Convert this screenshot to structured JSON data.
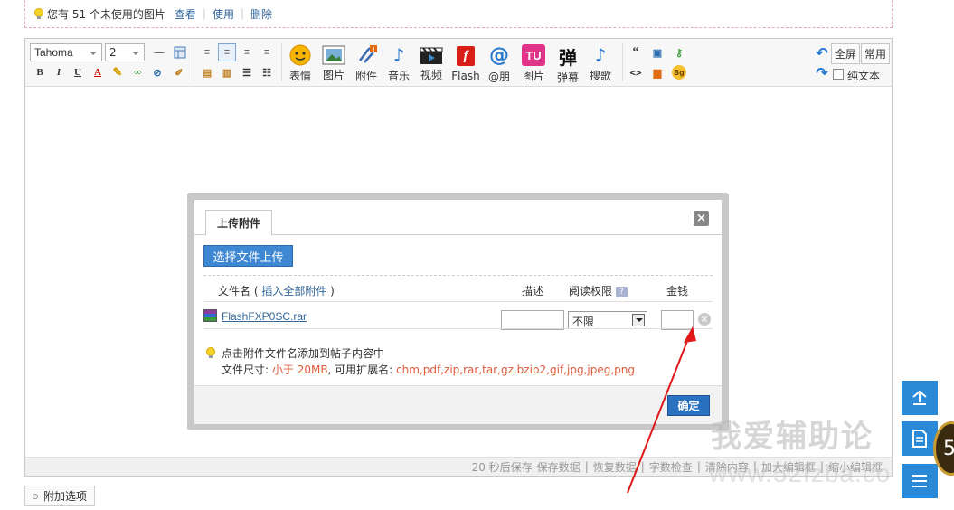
{
  "notice": {
    "text": "您有 51 个未使用的图片",
    "view": "查看",
    "use": "使用",
    "delete": "删除"
  },
  "toolbar": {
    "font": "Tahoma",
    "size": "2",
    "fmt_buttons": [
      "B",
      "I",
      "U",
      "A"
    ],
    "big_buttons": [
      {
        "label": "表情",
        "icon": "smiley-icon"
      },
      {
        "label": "图片",
        "icon": "image-icon"
      },
      {
        "label": "附件",
        "icon": "paperclip-icon"
      },
      {
        "label": "音乐",
        "icon": "music-note-icon"
      },
      {
        "label": "视频",
        "icon": "video-clapper-icon"
      },
      {
        "label": "Flash",
        "icon": "flash-icon"
      },
      {
        "label": "@朋",
        "icon": "at-icon"
      },
      {
        "label": "图片",
        "icon": "tu-icon"
      },
      {
        "label": "弹幕",
        "icon": "danmu-icon"
      },
      {
        "label": "搜歌",
        "icon": "search-song-icon"
      }
    ],
    "fullscreen": "全屏",
    "common": "常用",
    "plaintext": "纯文本",
    "danmu_glyph": "弹",
    "tu_glyph": "TU",
    "bg_glyph": "Bg",
    "flash_glyph": "f"
  },
  "statusbar": {
    "autosave": "20 秒后保存",
    "items": [
      "保存数据",
      "恢复数据",
      "字数检查",
      "清除内容",
      "加大编辑框",
      "缩小编辑框"
    ]
  },
  "attach_options": "附加选项",
  "dialog": {
    "tab": "上传附件",
    "upload_button": "选择文件上传",
    "col_filename": "文件名",
    "insert_all": "插入全部附件",
    "col_desc": "描述",
    "col_permission": "阅读权限",
    "col_money": "金钱",
    "file": {
      "name": "FlashFXP0SC.rar",
      "permission": "不限"
    },
    "tip1": "点击附件文件名添加到帖子内容中",
    "tip2_prefix": "文件尺寸:",
    "tip2_size": "小于 20MB",
    "tip2_mid": ", 可用扩展名:",
    "tip2_ext": "chm,pdf,zip,rar,tar,gz,bzip2,gif,jpg,jpeg,png",
    "ok": "确定"
  },
  "watermark": {
    "cn": "我爱辅助论",
    "url": "www.52fzba.co"
  },
  "badge": "5"
}
